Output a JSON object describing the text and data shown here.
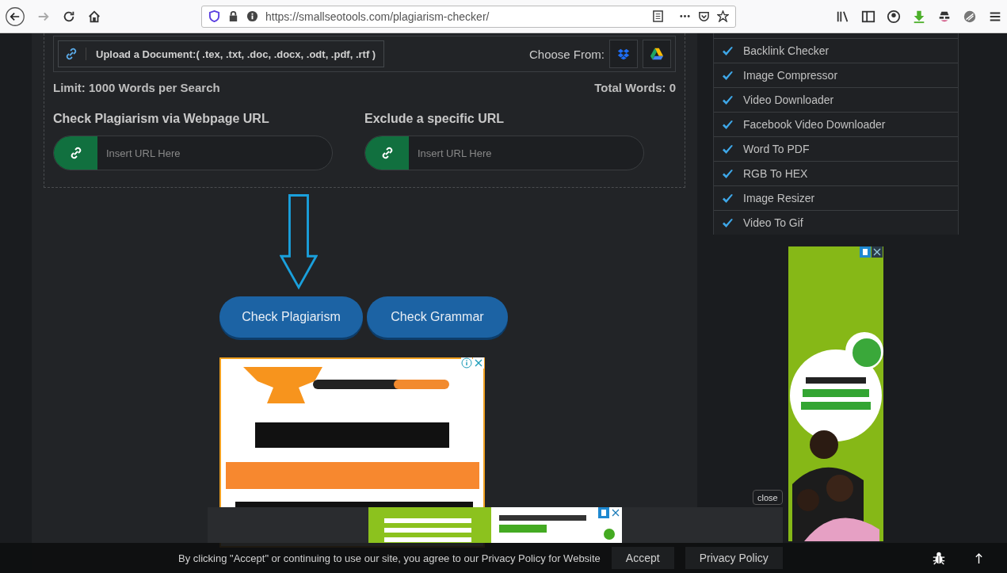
{
  "browser": {
    "url": "https://smallseotools.com/plagiarism-checker/"
  },
  "upload": {
    "label": "Upload a Document:( .tex, .txt, .doc, .docx, .odt, .pdf, .rtf )",
    "choose_label": "Choose From:"
  },
  "limit": "Limit: 1000 Words per Search",
  "total_words": "Total Words: 0",
  "url_fields": [
    {
      "label": "Check Plagiarism via Webpage URL",
      "placeholder": "Insert URL Here"
    },
    {
      "label": "Exclude a specific URL",
      "placeholder": "Insert URL Here"
    }
  ],
  "buttons": [
    "Check Plagiarism",
    "Check Grammar"
  ],
  "sidebar": {
    "items": [
      {
        "label": "Backlink Checker"
      },
      {
        "label": "Image Compressor"
      },
      {
        "label": "Video Downloader"
      },
      {
        "label": "Facebook Video Downloader"
      },
      {
        "label": "Word To PDF"
      },
      {
        "label": "RGB To HEX"
      },
      {
        "label": "Image Resizer"
      },
      {
        "label": "Video To Gif"
      }
    ]
  },
  "sticky_ad": {
    "close_label": "close"
  },
  "cookie_bar": {
    "text": "By clicking \"Accept\" or continuing to use our site, you agree to our Privacy Policy for Website",
    "accept": "Accept",
    "privacy": "Privacy Policy"
  }
}
